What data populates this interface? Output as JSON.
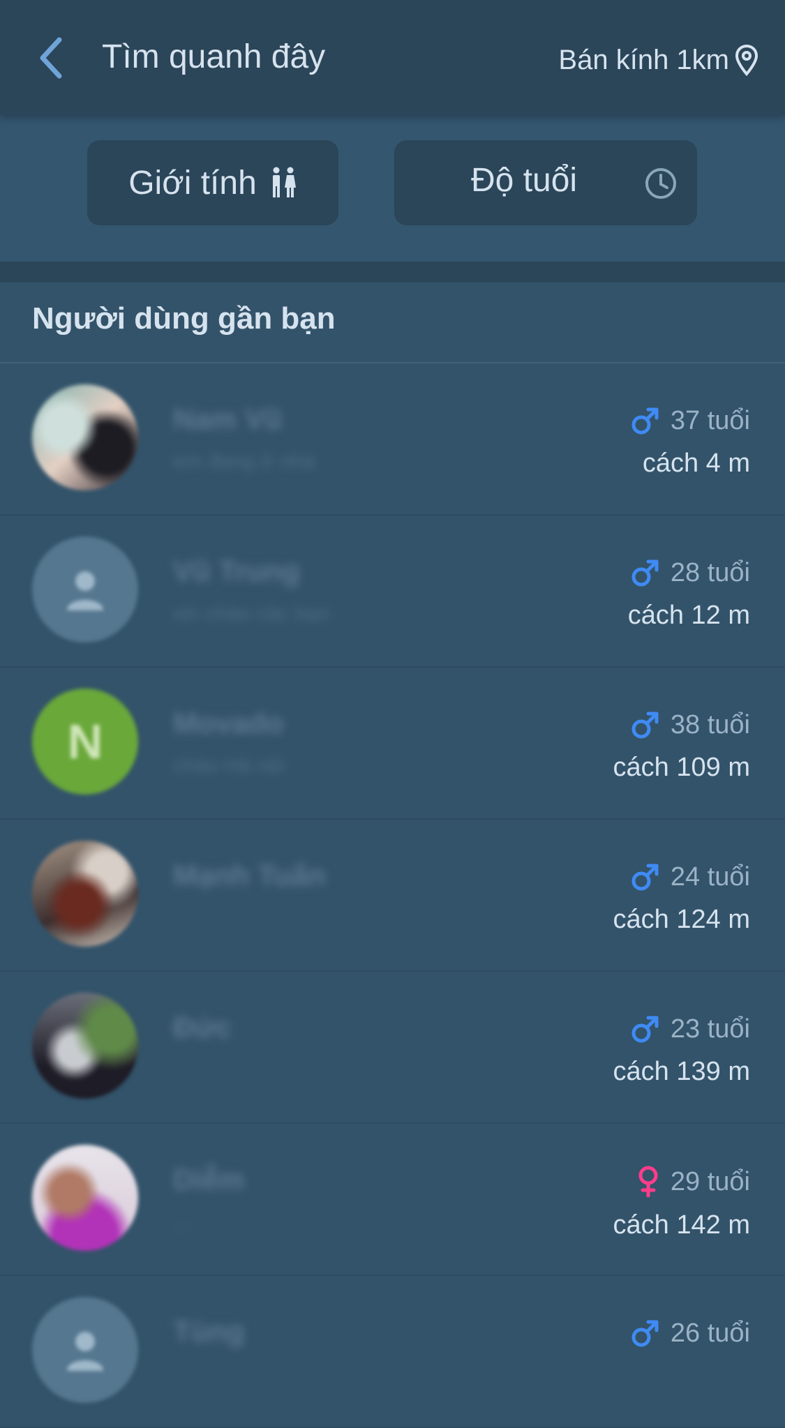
{
  "header": {
    "title": "Tìm quanh đây",
    "radius_label": "Bán kính 1km"
  },
  "filters": {
    "gender_label": "Giới tính",
    "age_label": "Độ tuổi"
  },
  "section": {
    "title": "Người dùng gần bạn"
  },
  "colors": {
    "header_bg": "#2b4559",
    "page_bg": "#33536a",
    "male": "#3f8bf5",
    "female": "#ff3d8b"
  },
  "users": [
    {
      "name": "Nam Vũ",
      "status": "em đang ở nhà",
      "age": "37 tuổi",
      "distance": "cách 4 m",
      "gender": "male",
      "avatar": "photo"
    },
    {
      "name": "Vũ Trung",
      "status": "xin chào các bạn",
      "age": "28 tuổi",
      "distance": "cách 12 m",
      "gender": "male",
      "avatar": "placeholder"
    },
    {
      "name": "Movado",
      "status": "chào Hà nội",
      "age": "38 tuổi",
      "distance": "cách 109 m",
      "gender": "male",
      "avatar": "letter",
      "avatar_letter": "N"
    },
    {
      "name": "Mạnh Tuấn",
      "status": "",
      "age": "24 tuổi",
      "distance": "cách 124 m",
      "gender": "male",
      "avatar": "photo"
    },
    {
      "name": "Đức",
      "status": "",
      "age": "23 tuổi",
      "distance": "cách 139 m",
      "gender": "male",
      "avatar": "photo"
    },
    {
      "name": "Diễm",
      "status": "...",
      "age": "29 tuổi",
      "distance": "cách 142 m",
      "gender": "female",
      "avatar": "photo"
    },
    {
      "name": "Tùng",
      "status": "",
      "age": "26 tuổi",
      "distance": "",
      "gender": "male",
      "avatar": "placeholder"
    }
  ]
}
